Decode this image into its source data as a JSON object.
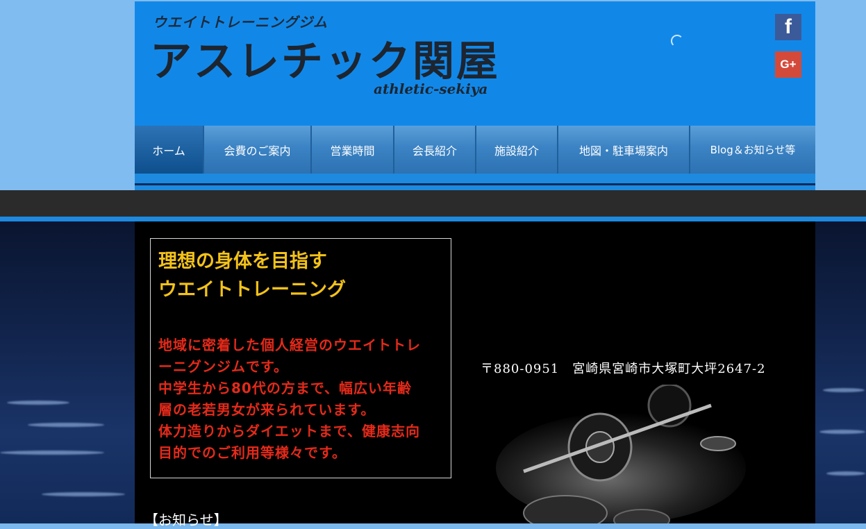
{
  "header": {
    "tagline": "ウエイトトレーニングジム",
    "logo": "アスレチック関屋",
    "logo_sub": "athletic-sekiya",
    "social": {
      "facebook_glyph": "f",
      "googleplus_glyph": "G+"
    }
  },
  "nav": {
    "items": [
      {
        "label": "ホーム"
      },
      {
        "label": "会費のご案内"
      },
      {
        "label": "営業時間"
      },
      {
        "label": "会長紹介"
      },
      {
        "label": "施設紹介"
      },
      {
        "label": "地図・駐車場案内"
      },
      {
        "label": "Blog＆お知らせ等"
      }
    ]
  },
  "main": {
    "intro": {
      "heading_line1": "理想の身体を目指す",
      "heading_line2": "ウエイトトレーニング",
      "body_line1": "地域に密着した個人経営のウエイトトレ",
      "body_line2": "ーニグンジムです。",
      "body_line3": "中学生から80代の方まで、幅広い年齢",
      "body_line4": "層の老若男女が来られています。",
      "body_line5": "体力造りからダイエットまで、健康志向",
      "body_line6": "目的でのご利用等様々です。"
    },
    "address": "〒880-0951　宮崎県宮崎市大塚町大坪2647-2",
    "notice_heading": "【お知らせ】"
  },
  "colors": {
    "header_blue": "#1188e8",
    "heading_yellow": "#f3c21a",
    "body_red": "#e52a1a",
    "facebook": "#3b5a99",
    "googleplus": "#d44a3a"
  }
}
